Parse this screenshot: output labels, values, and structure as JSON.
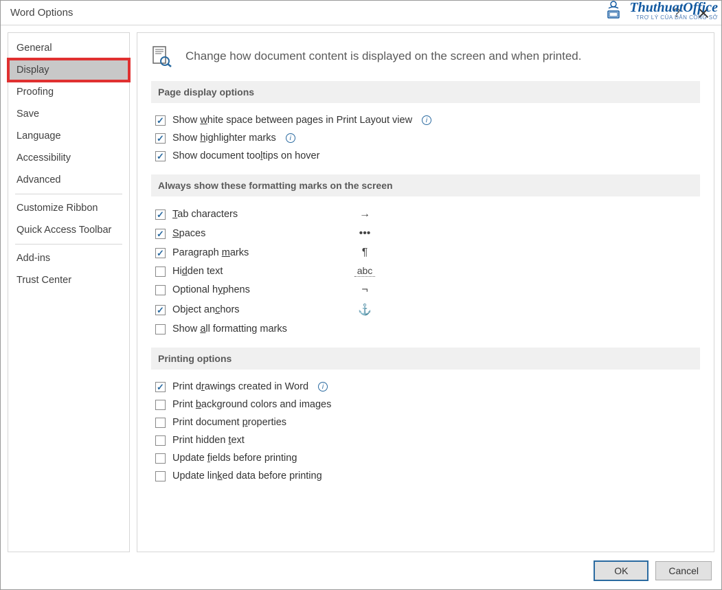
{
  "window": {
    "title": "Word Options",
    "help_label": "?",
    "close_label": "Close"
  },
  "sidebar": {
    "items": [
      {
        "label": "General",
        "selected": false
      },
      {
        "label": "Display",
        "selected": true
      },
      {
        "label": "Proofing",
        "selected": false
      },
      {
        "label": "Save",
        "selected": false
      },
      {
        "label": "Language",
        "selected": false
      },
      {
        "label": "Accessibility",
        "selected": false
      },
      {
        "label": "Advanced",
        "selected": false
      },
      {
        "label": "Customize Ribbon",
        "selected": false
      },
      {
        "label": "Quick Access Toolbar",
        "selected": false
      },
      {
        "label": "Add-ins",
        "selected": false
      },
      {
        "label": "Trust Center",
        "selected": false
      }
    ],
    "separators_after": [
      6,
      8
    ]
  },
  "content": {
    "header": "Change how document content is displayed on the screen and when printed.",
    "sections": [
      {
        "title": "Page display options",
        "type": "plain",
        "items": [
          {
            "label": "Show white space between pages in Print Layout view",
            "checked": true,
            "info": true,
            "u": 5
          },
          {
            "label": "Show highlighter marks",
            "checked": true,
            "info": true,
            "u": 5
          },
          {
            "label": "Show document tooltips on hover",
            "checked": true,
            "u": 17
          }
        ]
      },
      {
        "title": "Always show these formatting marks on the screen",
        "type": "fmt",
        "items": [
          {
            "label": "Tab characters",
            "checked": true,
            "symbol": "→",
            "u": 0
          },
          {
            "label": "Spaces",
            "checked": true,
            "symbol": "•••",
            "u": 0
          },
          {
            "label": "Paragraph marks",
            "checked": true,
            "symbol": "¶",
            "u": 10
          },
          {
            "label": "Hidden text",
            "checked": false,
            "symbol": "abc",
            "abc": true,
            "u": 2
          },
          {
            "label": "Optional hyphens",
            "checked": false,
            "symbol": "¬",
            "u": 10
          },
          {
            "label": "Object anchors",
            "checked": true,
            "symbol": "⚓",
            "blue": true,
            "u": 9
          },
          {
            "label": "Show all formatting marks",
            "checked": false,
            "u": 5
          }
        ]
      },
      {
        "title": "Printing options",
        "type": "plain",
        "items": [
          {
            "label": "Print drawings created in Word",
            "checked": true,
            "info": true,
            "u": 7
          },
          {
            "label": "Print background colors and images",
            "checked": false,
            "u": 6
          },
          {
            "label": "Print document properties",
            "checked": false,
            "u": 15
          },
          {
            "label": "Print hidden text",
            "checked": false,
            "u": 13
          },
          {
            "label": "Update fields before printing",
            "checked": false,
            "u": 7
          },
          {
            "label": "Update linked data before printing",
            "checked": false,
            "u": 10
          }
        ]
      }
    ]
  },
  "footer": {
    "ok": "OK",
    "cancel": "Cancel"
  },
  "watermark": {
    "brand": "ThuthuatOffice",
    "tag": "TRỢ LÝ CỦA DÂN CÔNG SỞ"
  }
}
